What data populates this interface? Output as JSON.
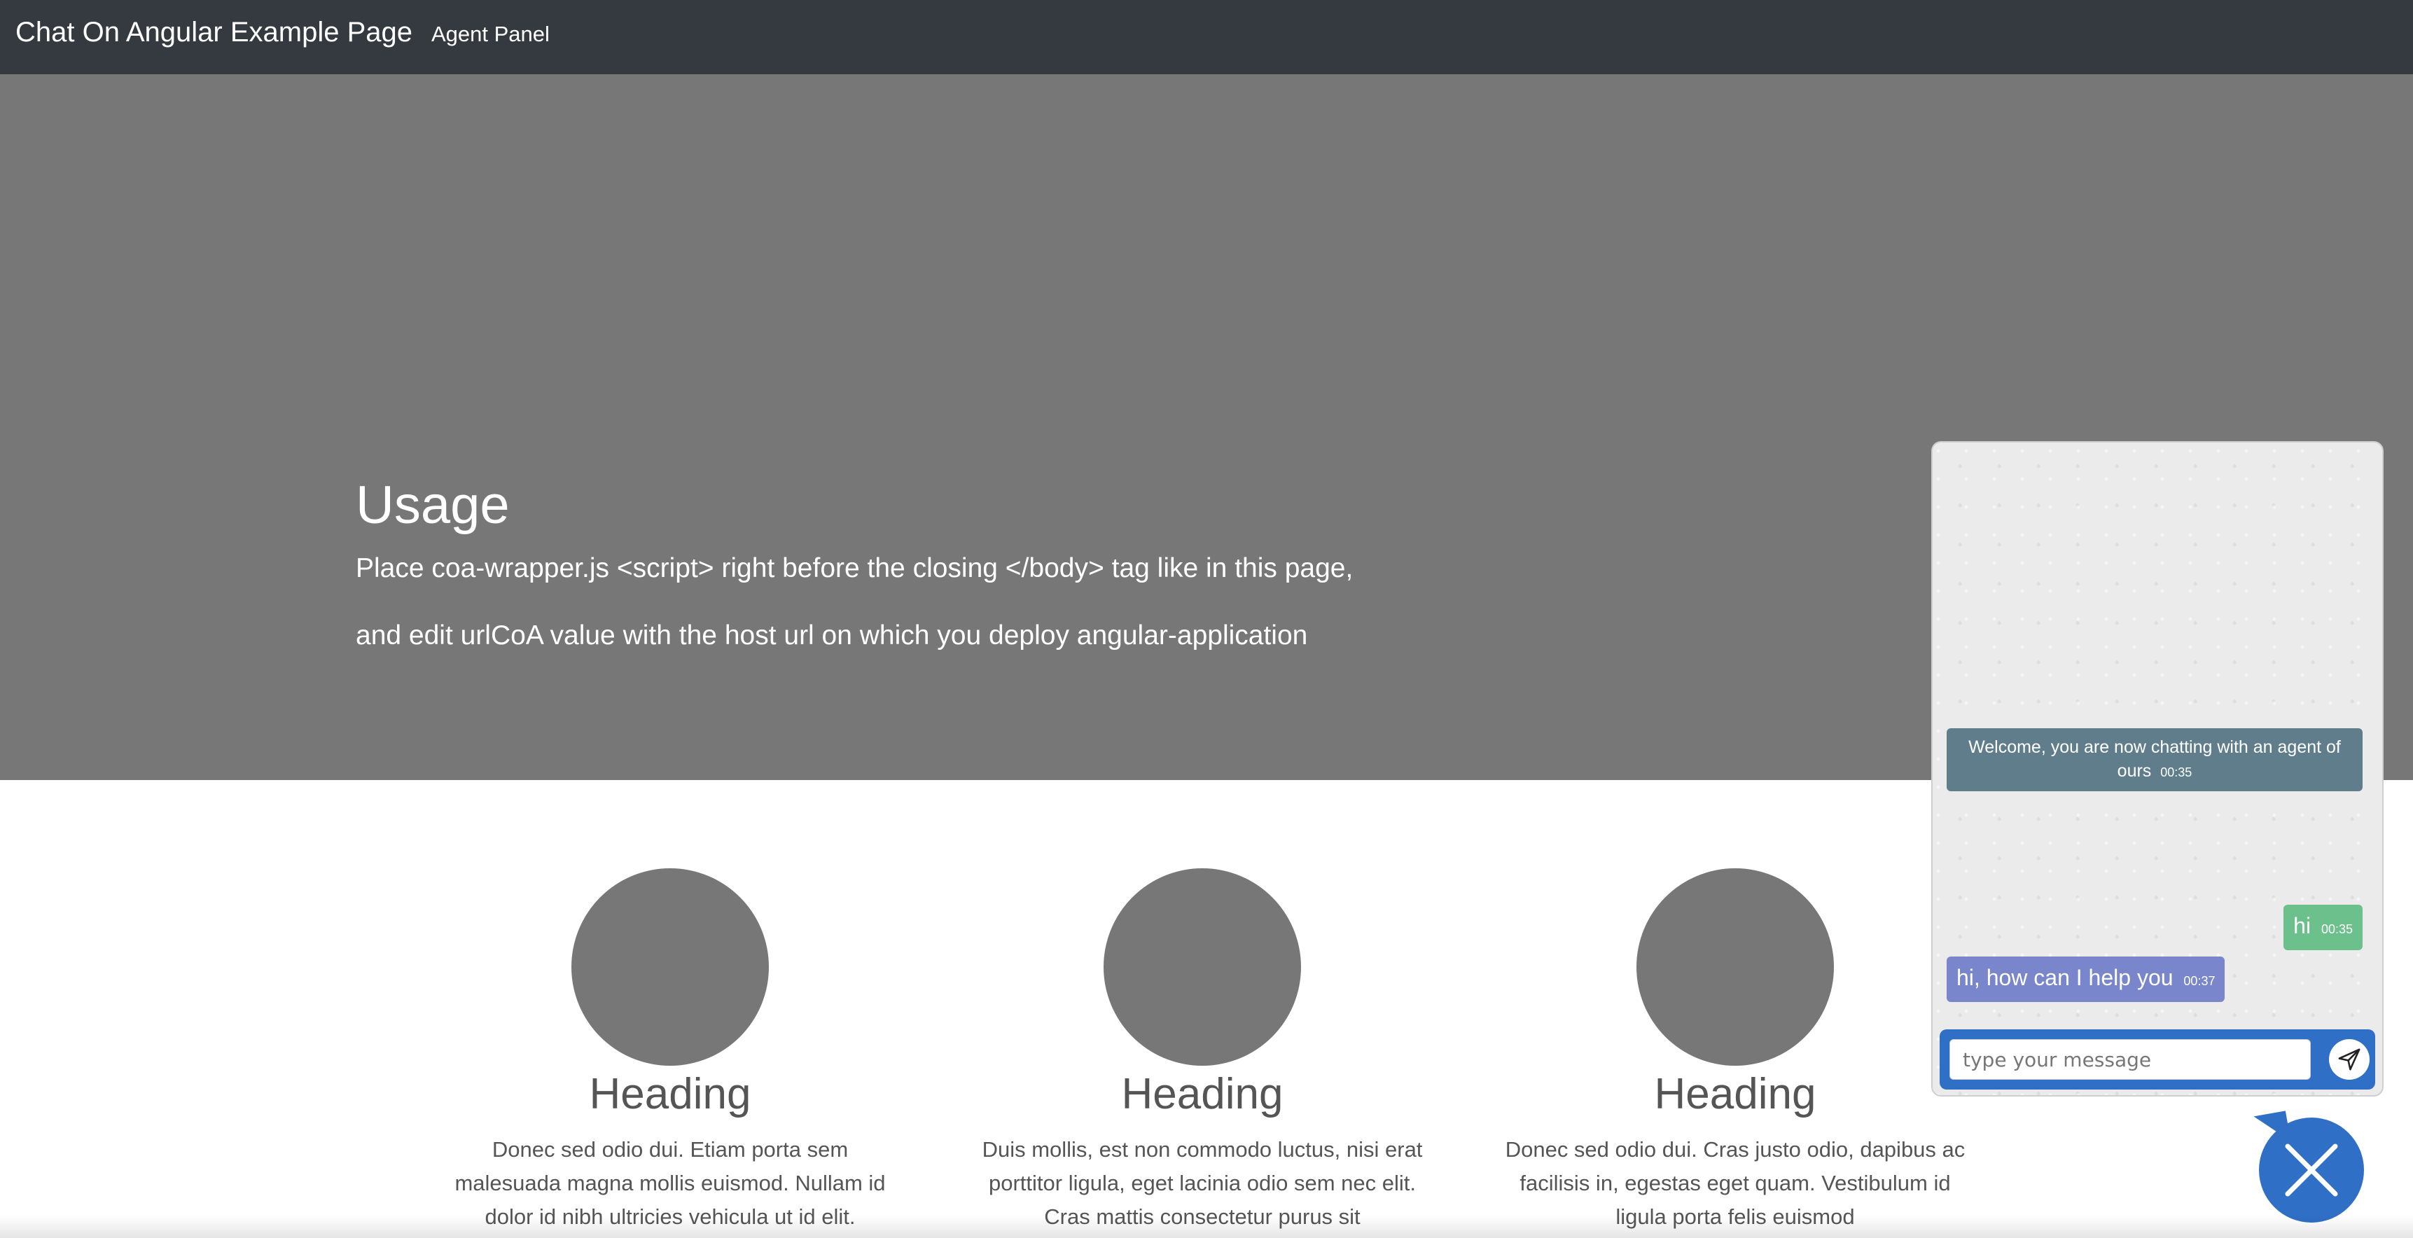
{
  "navbar": {
    "brand": "Chat On Angular Example Page",
    "link": "Agent Panel",
    "background": "#343a40"
  },
  "hero": {
    "title": "Usage",
    "line1": "Place coa-wrapper.js <script> right before the closing </body> tag like in this page,",
    "line2": "and edit urlCoA value with the host url on which you deploy angular-application",
    "background": "#777777"
  },
  "columns": [
    {
      "heading": "Heading",
      "text": "Donec sed odio dui. Etiam porta sem malesuada magna mollis euismod. Nullam id dolor id nibh ultricies vehicula ut id elit."
    },
    {
      "heading": "Heading",
      "text": "Duis mollis, est non commodo luctus, nisi erat porttitor ligula, eget lacinia odio sem nec elit. Cras mattis consectetur purus sit"
    },
    {
      "heading": "Heading",
      "text": "Donec sed odio dui. Cras justo odio, dapibus ac facilisis in, egestas eget quam. Vestibulum id ligula porta felis euismod"
    }
  ],
  "chat": {
    "messages": [
      {
        "kind": "system",
        "text": "Welcome, you are now chatting with an agent of ours",
        "time": "00:35",
        "color": "#607d8b"
      },
      {
        "kind": "user",
        "text": "hi",
        "time": "00:35",
        "color": "#6cc08b"
      },
      {
        "kind": "agent",
        "text": "hi, how can I help you",
        "time": "00:37",
        "color": "#7986cb"
      }
    ],
    "input_placeholder": "type your message",
    "input_value": "",
    "send_icon": "send-icon",
    "accent": "#2f6fc6"
  },
  "toggle": {
    "icon": "close-icon"
  }
}
